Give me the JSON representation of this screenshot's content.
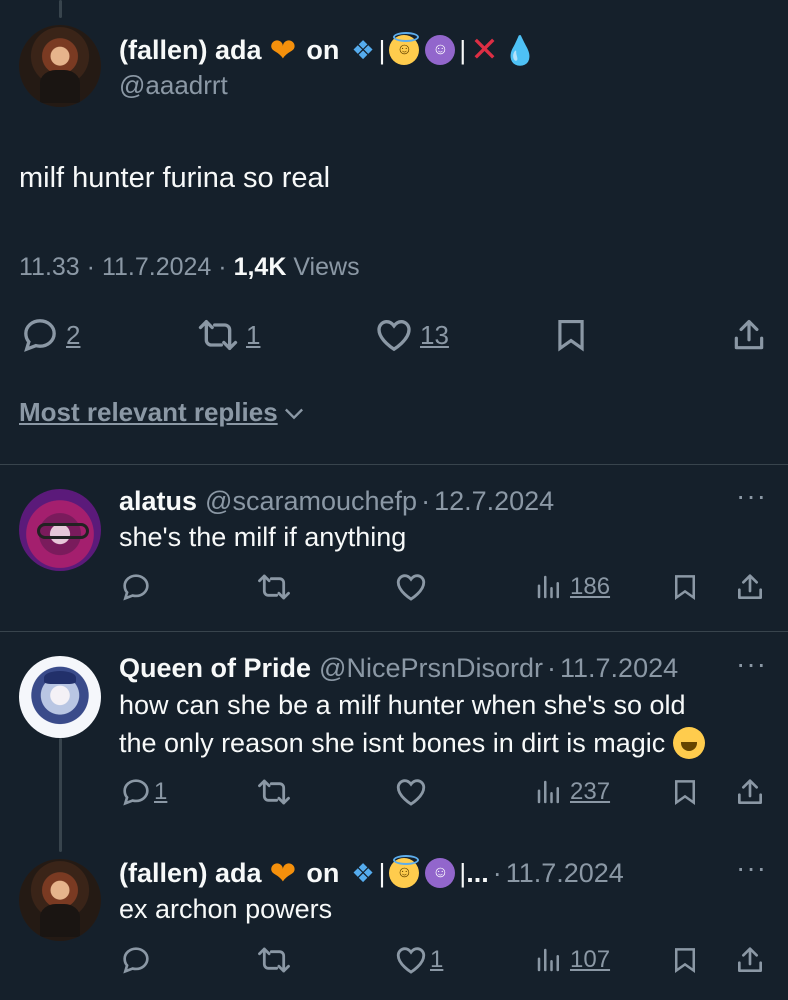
{
  "main_tweet": {
    "name": "(fallen) ada",
    "name_suffix": "on",
    "handle": "@aaadrrt",
    "text": "milf hunter furina so real",
    "time": "11.33",
    "date": "11.7.2024",
    "views_count": "1,4K",
    "views_label": "Views",
    "replies": "2",
    "reposts": "1",
    "likes": "13"
  },
  "replies_sort": {
    "label": "Most relevant replies"
  },
  "replies": [
    {
      "name": "alatus",
      "handle": "@scaramouchefp",
      "date": "12.7.2024",
      "text": "she's the milf if anything",
      "reply_count": "",
      "like_count": "",
      "views": "186"
    },
    {
      "name": "Queen of Pride",
      "handle": "@NicePrsnDisordr",
      "date": "11.7.2024",
      "text_line1": "how can she be a milf hunter when she's so old",
      "text_line2": "the only reason she isnt bones in dirt is magic",
      "reply_count": "1",
      "like_count": "",
      "views": "237"
    },
    {
      "name": "(fallen) ada",
      "name_suffix": "on",
      "truncation": "...",
      "date": "11.7.2024",
      "text": "ex archon powers",
      "reply_count": "",
      "like_count": "1",
      "views": "107"
    }
  ],
  "separator": "·",
  "colors": {
    "bg": "#15202b",
    "text": "#f7f9f9",
    "muted": "#8b98a5",
    "divider": "#38444d"
  },
  "icons": [
    "reply-icon",
    "repost-icon",
    "like-icon",
    "bookmark-icon",
    "share-icon",
    "views-icon",
    "more-icon",
    "chevron-down-icon"
  ]
}
